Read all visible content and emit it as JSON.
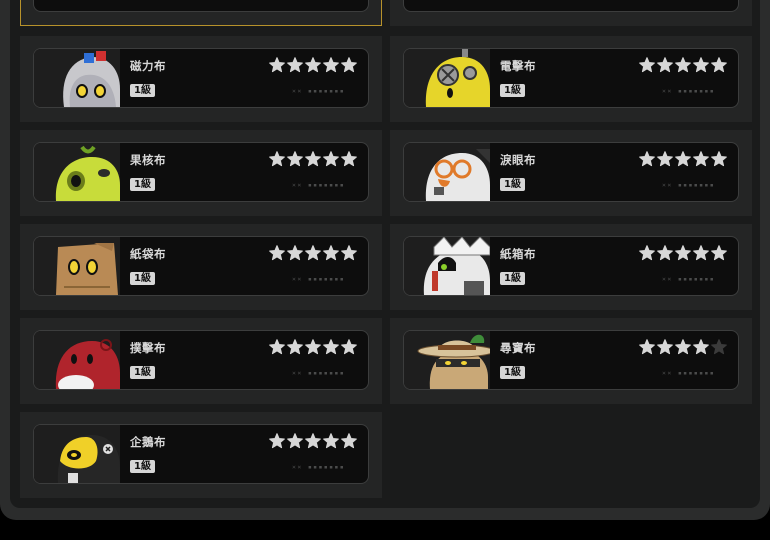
{
  "colors": {
    "star_filled": "#d7d7d7",
    "star_empty": "#3b3b3b",
    "selected_border": "#b7922b",
    "level_badge": "#d6d6d6"
  },
  "cards": [
    {
      "name": "磁力布",
      "level": "1級",
      "stars": 5,
      "progress": "×× ▪▪▪▪▪▪▪",
      "icon": "magnet-cloth-icon"
    },
    {
      "name": "電擊布",
      "level": "1級",
      "stars": 5,
      "progress": "×× ▪▪▪▪▪▪▪",
      "icon": "electric-cloth-icon"
    },
    {
      "name": "果核布",
      "level": "1級",
      "stars": 5,
      "progress": "×× ▪▪▪▪▪▪▪",
      "icon": "fruit-core-cloth-icon"
    },
    {
      "name": "淚眼布",
      "level": "1級",
      "stars": 5,
      "progress": "×× ▪▪▪▪▪▪▪",
      "icon": "teary-eye-cloth-icon"
    },
    {
      "name": "紙袋布",
      "level": "1級",
      "stars": 5,
      "progress": "×× ▪▪▪▪▪▪▪",
      "icon": "paper-bag-cloth-icon"
    },
    {
      "name": "紙箱布",
      "level": "1級",
      "stars": 5,
      "progress": "×× ▪▪▪▪▪▪▪",
      "icon": "cardboard-box-cloth-icon"
    },
    {
      "name": "撲擊布",
      "level": "1級",
      "stars": 5,
      "progress": "×× ▪▪▪▪▪▪▪",
      "icon": "pounce-cloth-icon"
    },
    {
      "name": "尋寶布",
      "level": "1級",
      "stars": 4,
      "progress": "×× ▪▪▪▪▪▪▪",
      "icon": "treasure-hunt-cloth-icon"
    },
    {
      "name": "企鵝布",
      "level": "1級",
      "stars": 5,
      "progress": "×× ▪▪▪▪▪▪▪",
      "icon": "penguin-cloth-icon"
    }
  ]
}
